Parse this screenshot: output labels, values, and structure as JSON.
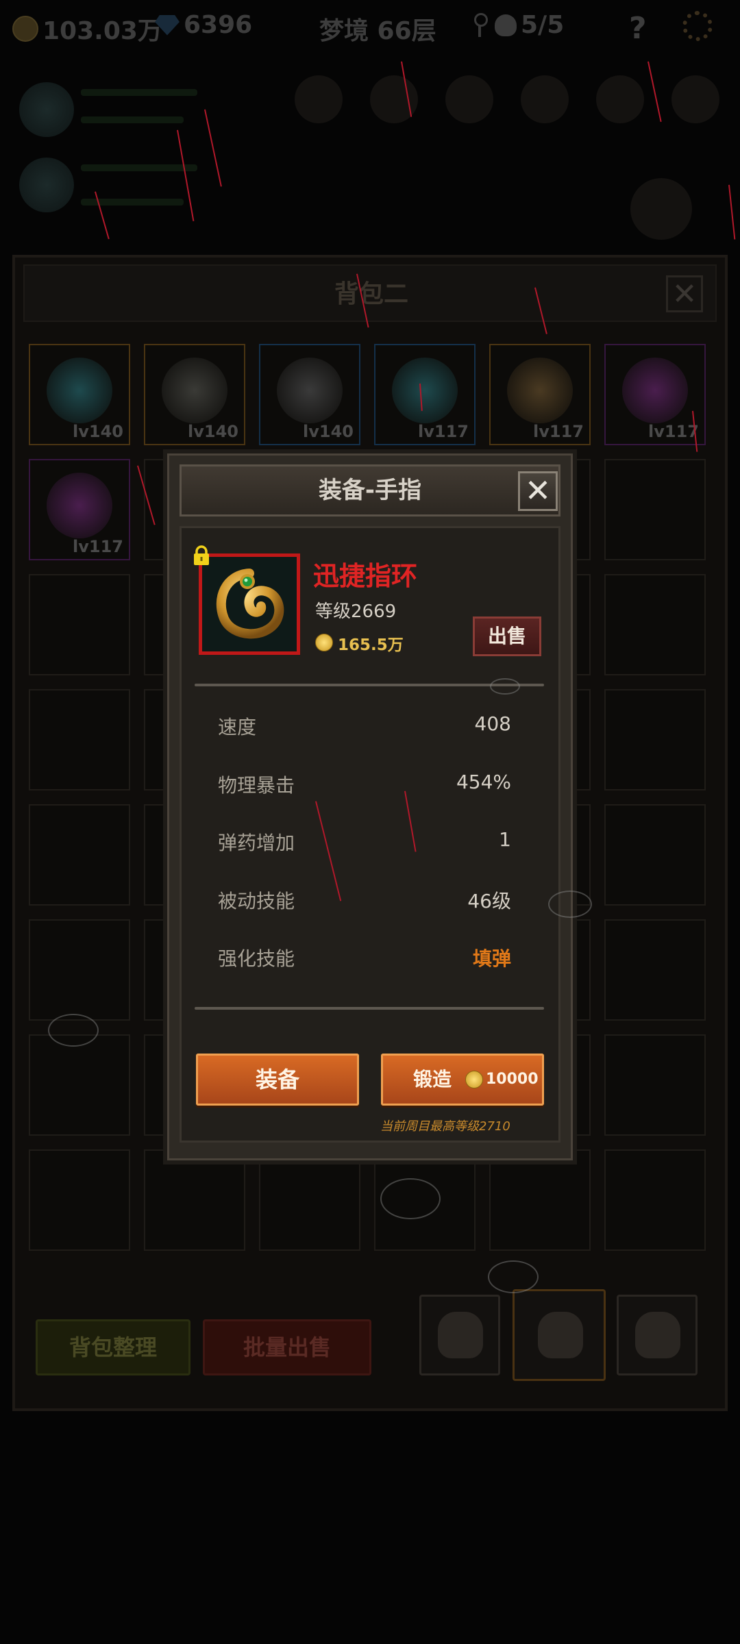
{
  "hud": {
    "gold": "103.03万",
    "gems": "6396",
    "stage": "梦境 66层",
    "skull_count": "5/5",
    "help": "?"
  },
  "bag": {
    "title": "背包二",
    "close": "✕",
    "items": [
      {
        "level": "lv140",
        "rarity": "orange",
        "art_color": "#1e4a4e"
      },
      {
        "level": "lv140",
        "rarity": "orange",
        "art_color": "#3a3a36"
      },
      {
        "level": "lv140",
        "rarity": "blue",
        "art_color": "#3a3a3a"
      },
      {
        "level": "lv117",
        "rarity": "blue",
        "art_color": "#1e4a4e"
      },
      {
        "level": "lv117",
        "rarity": "orange",
        "art_color": "#4a3a22"
      },
      {
        "level": "lv117",
        "rarity": "purple",
        "art_color": "#4a1e4e"
      },
      {
        "level": "lv117",
        "rarity": "purple",
        "art_color": "#4a1e4e"
      }
    ],
    "sort_button": "背包整理",
    "bulk_sell_button": "批量出售"
  },
  "dialog": {
    "title": "装备-手指",
    "close": "✕",
    "item": {
      "name": "迅捷指环",
      "level": "等级2669",
      "price": "165.5万",
      "sell_button": "出售"
    },
    "stats": [
      {
        "label": "速度",
        "value": "408"
      },
      {
        "label": "物理暴击",
        "value": "454%"
      },
      {
        "label": "弹药增加",
        "value": "1"
      },
      {
        "label": "被动技能",
        "value": "46级"
      },
      {
        "label": "强化技能",
        "value": "填弹",
        "highlight": true
      }
    ],
    "equip_button": "装备",
    "forge_button": "锻造",
    "forge_cost": "10000",
    "footnote": "当前周目最高等级2710"
  },
  "colors": {
    "item_name": "#e02424",
    "accent_orange": "#d86a24",
    "price_gold": "#e8c050",
    "highlight_stat": "#e07818"
  }
}
